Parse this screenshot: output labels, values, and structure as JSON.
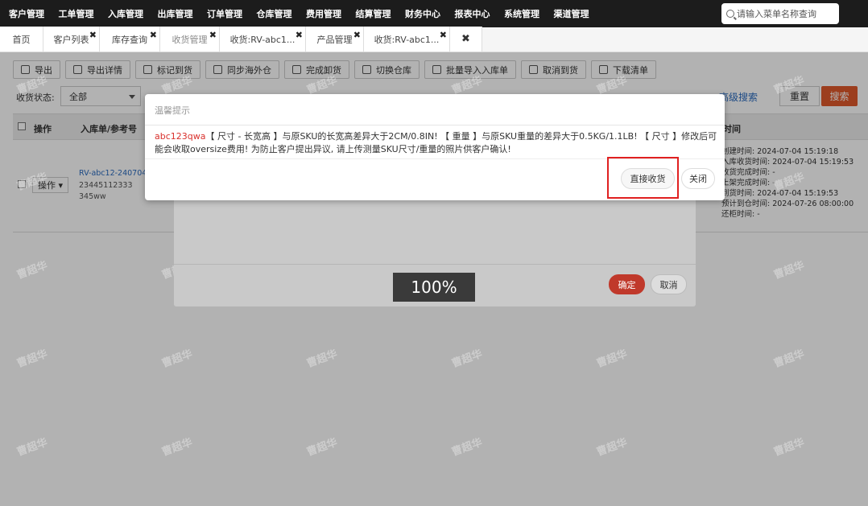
{
  "nav": {
    "items": [
      "客户管理",
      "工单管理",
      "入库管理",
      "出库管理",
      "订单管理",
      "仓库管理",
      "费用管理",
      "结算管理",
      "财务中心",
      "报表中心",
      "系统管理",
      "渠道管理"
    ],
    "search_placeholder": "请输入菜单名称查询"
  },
  "tabs": [
    {
      "label": "首页"
    },
    {
      "label": "客户列表"
    },
    {
      "label": "库存查询"
    },
    {
      "label": "收货管理"
    },
    {
      "label": "收货:RV-abc1..."
    },
    {
      "label": "产品管理"
    },
    {
      "label": "收货:RV-abc1..."
    }
  ],
  "tab_close_all": "✖",
  "toolbar": [
    "导出",
    "导出详情",
    "标记到货",
    "同步海外仓",
    "完成卸货",
    "切换仓库",
    "批量导入入库单",
    "取消到货",
    "下载清单"
  ],
  "filter": {
    "label": "收货状态:",
    "value": "全部",
    "advanced": "高级搜索",
    "reset": "重置",
    "search": "搜索"
  },
  "table": {
    "headers": {
      "op": "操作",
      "order": "入库单/参考号",
      "time": "时间"
    },
    "row": {
      "op_btn": "操作",
      "order_no": "RV-abc12-240704-",
      "ref1": "23445112333",
      "ref2": "345ww",
      "times": [
        "创建时间: 2024-07-04 15:19:18",
        "入库收货时间: 2024-07-04 15:19:53",
        "收货完成时间: -",
        "上架完成时间: -",
        "到货时间: 2024-07-04 15:19:53",
        "预计到仓时间: 2024-07-26 08:00:00",
        "还柜时间: -"
      ]
    }
  },
  "watermark": "曹超华",
  "dialog2": {
    "ok": "确定",
    "cancel": "取消",
    "progress": "100%"
  },
  "dialog": {
    "title": "温馨提示",
    "sku": "abc123qwa",
    "message": "【 尺寸 - 长宽高 】与原SKU的长宽高差异大于2CM/0.8IN! 【 重量 】与原SKU重量的差异大于0.5KG/1.1LB! 【 尺寸 】修改后可能会收取oversize费用! 为防止客户提出异议, 请上传测量SKU尺寸/重量的照片供客户确认!",
    "direct_receive": "直接收货",
    "close": "关闭"
  }
}
